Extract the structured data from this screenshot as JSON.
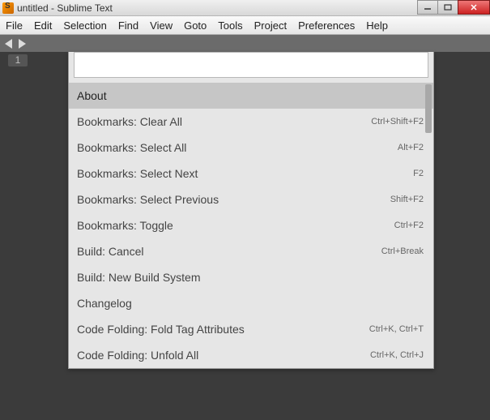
{
  "window": {
    "title": "untitled - Sublime Text"
  },
  "menubar": {
    "file": "File",
    "edit": "Edit",
    "selection": "Selection",
    "find": "Find",
    "view": "View",
    "goto": "Goto",
    "tools": "Tools",
    "project": "Project",
    "preferences": "Preferences",
    "help": "Help"
  },
  "gutter": {
    "line1": "1"
  },
  "palette": {
    "input_value": "",
    "input_placeholder": "",
    "items": [
      {
        "label": "About",
        "shortcut": ""
      },
      {
        "label": "Bookmarks: Clear All",
        "shortcut": "Ctrl+Shift+F2"
      },
      {
        "label": "Bookmarks: Select All",
        "shortcut": "Alt+F2"
      },
      {
        "label": "Bookmarks: Select Next",
        "shortcut": "F2"
      },
      {
        "label": "Bookmarks: Select Previous",
        "shortcut": "Shift+F2"
      },
      {
        "label": "Bookmarks: Toggle",
        "shortcut": "Ctrl+F2"
      },
      {
        "label": "Build: Cancel",
        "shortcut": "Ctrl+Break"
      },
      {
        "label": "Build: New Build System",
        "shortcut": ""
      },
      {
        "label": "Changelog",
        "shortcut": ""
      },
      {
        "label": "Code Folding: Fold Tag Attributes",
        "shortcut": "Ctrl+K, Ctrl+T"
      },
      {
        "label": "Code Folding: Unfold All",
        "shortcut": "Ctrl+K, Ctrl+J"
      }
    ]
  }
}
